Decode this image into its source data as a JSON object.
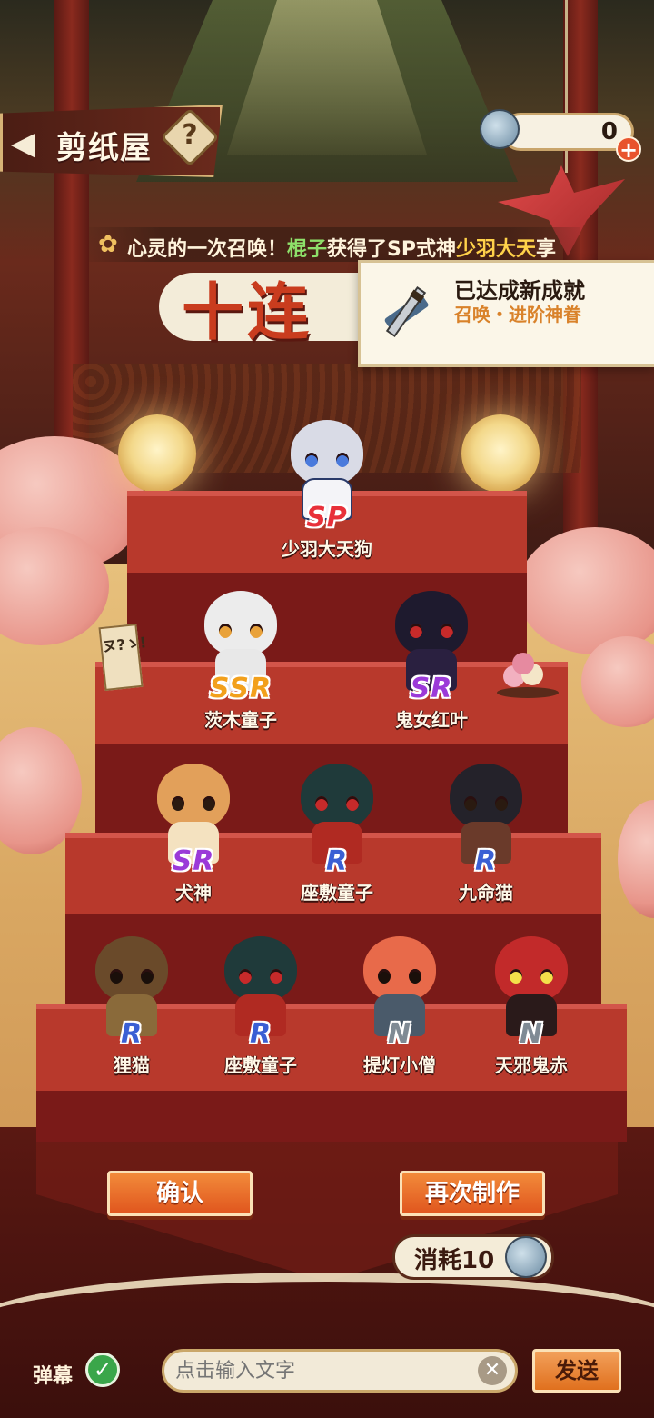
{
  "header": {
    "back_icon": "chevron-left-icon",
    "title": "剪纸屋",
    "help_label": "?",
    "currency": {
      "icon": "summon-ticket-icon",
      "value": "0",
      "plus_label": "+"
    }
  },
  "announcement": {
    "prefix": "心灵的一次召唤！",
    "player": "棍子",
    "middle": "获得了SP式神",
    "shikigami": "少羽大天",
    "suffix": "享"
  },
  "banner": {
    "title": "十连"
  },
  "achievement": {
    "title": "已达成新成就",
    "subtitle": "召唤・进阶神眷"
  },
  "note_card": {
    "text": "ヌ?ゝ!"
  },
  "results": [
    {
      "rarity": "SP",
      "name": "少羽大天狗"
    },
    {
      "rarity": "SSR",
      "name": "茨木童子"
    },
    {
      "rarity": "SR",
      "name": "鬼女红叶"
    },
    {
      "rarity": "SR",
      "name": "犬神"
    },
    {
      "rarity": "R",
      "name": "座敷童子"
    },
    {
      "rarity": "R",
      "name": "九命猫"
    },
    {
      "rarity": "R",
      "name": "狸猫"
    },
    {
      "rarity": "R",
      "name": "座敷童子"
    },
    {
      "rarity": "N",
      "name": "提灯小僧"
    },
    {
      "rarity": "N",
      "name": "天邪鬼赤"
    }
  ],
  "actions": {
    "confirm_label": "确认",
    "again_label": "再次制作",
    "consume_label": "消耗10",
    "consume_icon": "summon-ticket-icon"
  },
  "danmu": {
    "label": "弹幕",
    "enabled": true,
    "check_icon": "check-icon",
    "placeholder": "点击输入文字",
    "clear_icon": "close-icon",
    "send_label": "发送"
  },
  "colors": {
    "sp": "#e8303a",
    "ssr": "#f2a01c",
    "sr": "#9b3ad8",
    "r": "#3a5fd4",
    "n": "#7f8a94",
    "button": "#e0561e",
    "step": "#b8392c"
  }
}
